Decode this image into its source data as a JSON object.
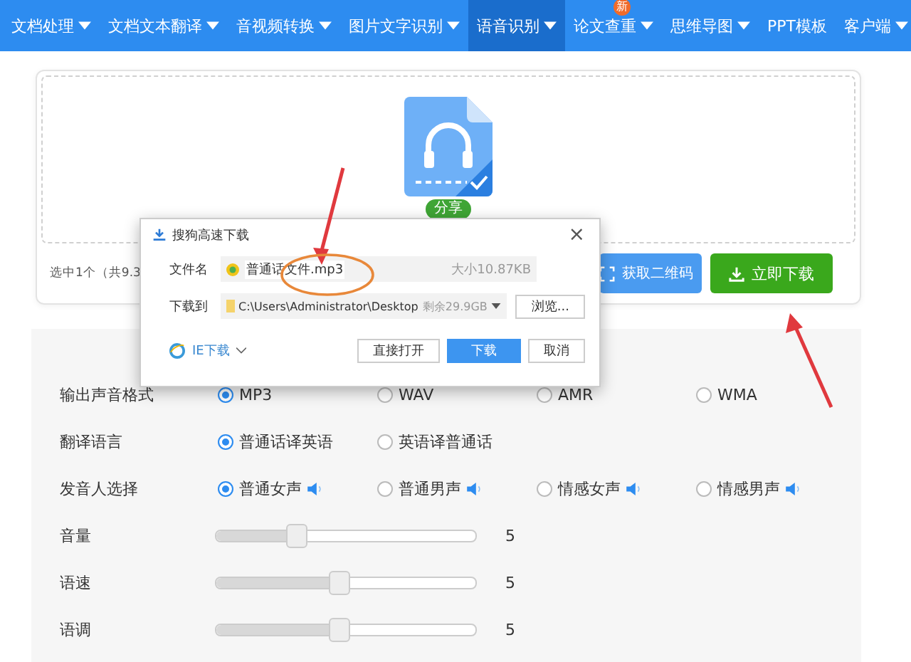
{
  "nav": [
    {
      "label": "文档处理",
      "caret": true,
      "selected": false
    },
    {
      "label": "文档文本翻译",
      "caret": true,
      "selected": false
    },
    {
      "label": "音视频转换",
      "caret": true,
      "selected": false
    },
    {
      "label": "图片文字识别",
      "caret": true,
      "selected": false
    },
    {
      "label": "语音识别",
      "caret": true,
      "selected": true
    },
    {
      "label": "论文查重",
      "caret": true,
      "selected": false,
      "badge": "新"
    },
    {
      "label": "思维导图",
      "caret": true,
      "selected": false
    },
    {
      "label": "PPT模板",
      "caret": false,
      "selected": false
    },
    {
      "label": "客户端",
      "caret": true,
      "selected": false
    }
  ],
  "upload": {
    "share": "分享",
    "summary": "选中1个（共9.3",
    "qr_button": "获取二维码",
    "download_button": "立即下载"
  },
  "dialog": {
    "title": "搜狗高速下载",
    "close": "×",
    "name_label": "文件名",
    "file_name": "普通话文件.mp3",
    "file_size": "大小10.87KB",
    "path_label": "下载到",
    "path": "C:\\Users\\Administrator\\Desktop",
    "free_space": "剩余29.9GB",
    "browse": "浏览...",
    "ie_download": "IE下载",
    "open_button": "直接打开",
    "download_button": "下载",
    "cancel_button": "取消"
  },
  "settings": [
    {
      "kind": "radio",
      "label": "输出声音格式",
      "options": [
        {
          "label": "MP3",
          "selected": true
        },
        {
          "label": "WAV",
          "selected": false
        },
        {
          "label": "AMR",
          "selected": false
        },
        {
          "label": "WMA",
          "selected": false
        }
      ]
    },
    {
      "kind": "radio",
      "label": "翻译语言",
      "options": [
        {
          "label": "普通话译英语",
          "selected": true
        },
        {
          "label": "英语译普通话",
          "selected": false
        }
      ]
    },
    {
      "kind": "radio",
      "label": "发音人选择",
      "options": [
        {
          "label": "普通女声",
          "selected": true,
          "speaker": true
        },
        {
          "label": "普通男声",
          "selected": false,
          "speaker": true
        },
        {
          "label": "情感女声",
          "selected": false,
          "speaker": true
        },
        {
          "label": "情感男声",
          "selected": false,
          "speaker": true
        }
      ]
    },
    {
      "kind": "slider",
      "label": "音量",
      "level": 0.31,
      "value": "5"
    },
    {
      "kind": "slider",
      "label": "语速",
      "level": 0.47,
      "value": "5"
    },
    {
      "kind": "slider",
      "label": "语调",
      "level": 0.47,
      "value": "5"
    }
  ]
}
